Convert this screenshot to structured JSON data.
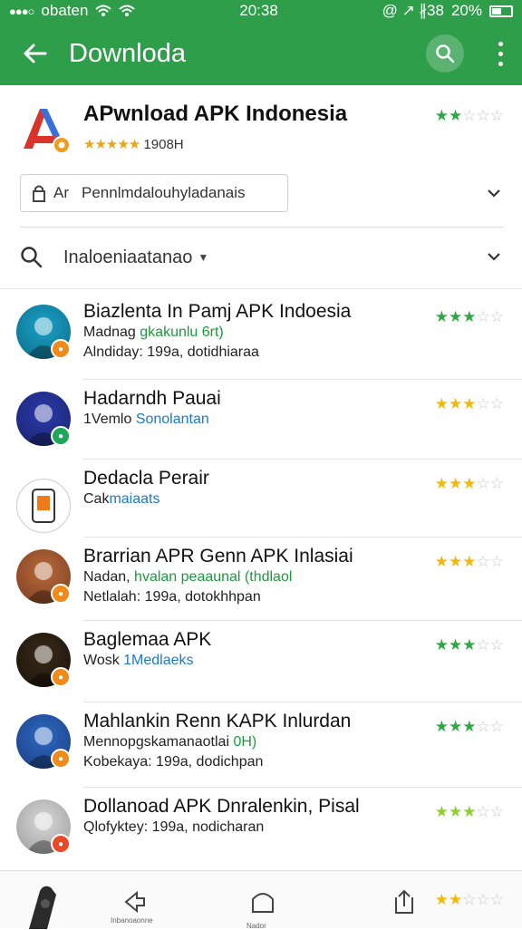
{
  "status": {
    "carrier": "obaten",
    "time": "20:38",
    "battery": "20%",
    "system": "@ ↗ ∦38"
  },
  "appbar": {
    "title": "Downloda",
    "back_icon": "arrow-left-icon",
    "search_icon": "search-icon",
    "menu_icon": "more-vert-icon"
  },
  "header": {
    "title": "APwnload APK Indonesia",
    "stars_text": "★★★★★",
    "count": "1908H",
    "rating": 2
  },
  "filter": {
    "prefix": "Ar",
    "value": "Pennlmdalouhyladanais"
  },
  "sort": {
    "label": "Inaloeniaatanao"
  },
  "items": [
    {
      "title": "Biazlenta In Pamj APK Indoesia",
      "line1_a": "Madnag ",
      "line1_b": "gkakunlu 6rt)",
      "line2": "Alndiday: 199a, dotidhiaraa",
      "rating": 3,
      "star_color": "#2fa844"
    },
    {
      "title": "Hadarndh Pauai",
      "line1_a": "1Vemlo ",
      "line1_b": "Sonolantan",
      "line2": "",
      "rating": 3,
      "star_color": "#f2b90c"
    },
    {
      "title": "Dedacla Perair",
      "line1_a": "Cak",
      "line1_b": "maiaats",
      "line2": "",
      "rating": 3,
      "star_color": "#f2b90c"
    },
    {
      "title": "Brarrian APR Genn APK Inlasiai",
      "line1_a": "Nadan, ",
      "line1_b": "hvalan peaaunal (thdlaol",
      "line2": "Netlalah: 199a, dotokhhpan",
      "rating": 3,
      "star_color": "#f2b90c"
    },
    {
      "title": "Baglemaa APK",
      "line1_a": "Wosk ",
      "line1_b": "1Medlaeks",
      "line2": "",
      "rating": 3,
      "star_color": "#2fa844"
    },
    {
      "title": "Mahlankin Renn KAPK Inlurdan",
      "line1_a": "Mennopgskamanaotlai ",
      "line1_b": "0H)",
      "line2": "Kobekaya: 199a, dodichpan",
      "rating": 3,
      "star_color": "#2fa844"
    },
    {
      "title": "Dollanoad APK Dnralenkin, Pisal",
      "line1_a": "Qlofyktey: 199a, nodicharan",
      "line1_b": "",
      "line2": "",
      "rating": 3,
      "star_color": "#8fcf2f"
    }
  ],
  "bottom": {
    "back_label": "Inbanoaonne",
    "home_label": "Nador",
    "share_icon": "share-icon",
    "rating": 2
  }
}
